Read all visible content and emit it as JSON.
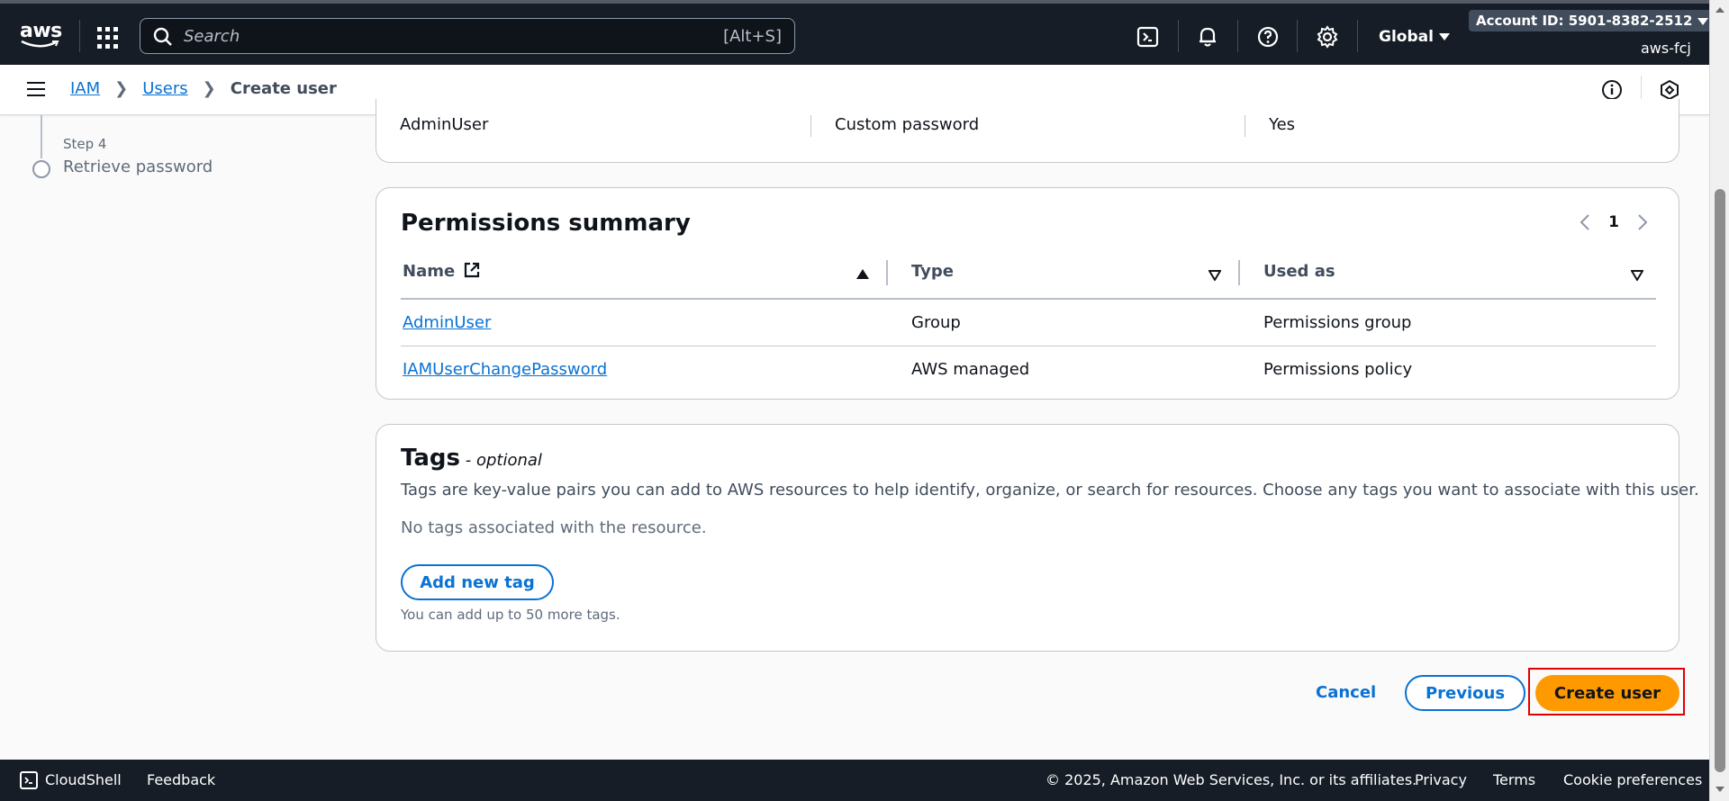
{
  "topnav": {
    "logo_text": "aws",
    "search": {
      "placeholder": "Search",
      "shortcut": "[Alt+S]"
    },
    "region": "Global",
    "account_id": "Account ID: 5901-8382-2512",
    "username": "aws-fcj"
  },
  "breadcrumb": {
    "items": [
      "IAM",
      "Users"
    ],
    "current": "Create user"
  },
  "steps": {
    "step_label": "Step 4",
    "step_title": "Retrieve password"
  },
  "user_details_row": [
    "AdminUser",
    "Custom password",
    "Yes"
  ],
  "permissions": {
    "title": "Permissions summary",
    "page": "1",
    "columns": [
      "Name",
      "Type",
      "Used as"
    ],
    "rows": [
      {
        "name": "AdminUser",
        "type": "Group",
        "used_as": "Permissions group"
      },
      {
        "name": "IAMUserChangePassword",
        "type": "AWS managed",
        "used_as": "Permissions policy"
      }
    ]
  },
  "tags": {
    "title": "Tags",
    "optional": " - optional",
    "description": "Tags are key-value pairs you can add to AWS resources to help identify, organize, or search for resources. Choose any tags you want to associate with this user.",
    "empty": "No tags associated with the resource.",
    "add_button": "Add new tag",
    "hint": "You can add up to 50 more tags."
  },
  "actions": {
    "cancel": "Cancel",
    "previous": "Previous",
    "create": "Create user"
  },
  "footer": {
    "cloudshell": "CloudShell",
    "feedback": "Feedback",
    "copyright": "© 2025, Amazon Web Services, Inc. or its affiliates.",
    "privacy": "Privacy",
    "terms": "Terms",
    "cookies": "Cookie preferences"
  },
  "colors": {
    "nav_bg": "#161d26",
    "link": "#0972d3",
    "primary_button": "#ff9900",
    "highlight": "#e00000"
  }
}
